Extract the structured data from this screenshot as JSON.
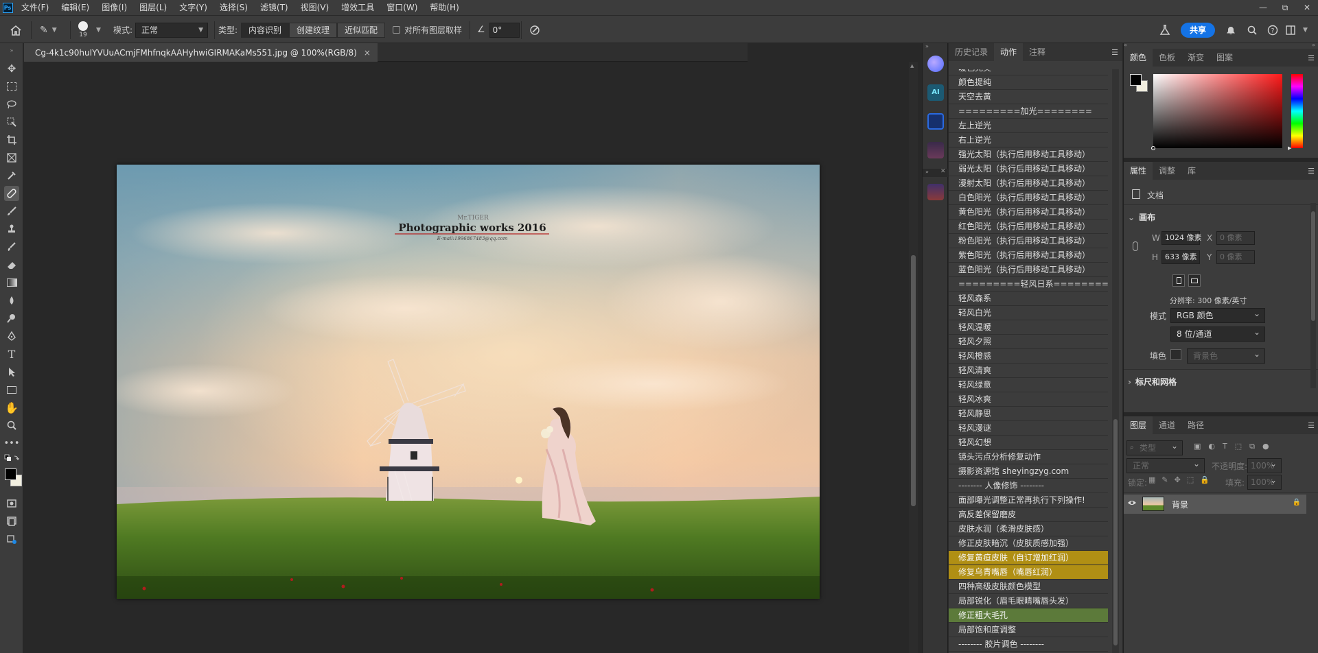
{
  "app": {
    "logo_text": "Ps"
  },
  "menubar": {
    "items": [
      "文件(F)",
      "编辑(E)",
      "图像(I)",
      "图层(L)",
      "文字(Y)",
      "选择(S)",
      "滤镜(T)",
      "视图(V)",
      "增效工具",
      "窗口(W)",
      "帮助(H)"
    ]
  },
  "window_controls": {
    "minimize": "—",
    "restore": "⧉",
    "close": "✕"
  },
  "options_bar": {
    "brush_size": "19",
    "mode_label": "模式:",
    "mode_value": "正常",
    "type_label": "类型:",
    "type_buttons": [
      "内容识别",
      "创建纹理",
      "近似匹配"
    ],
    "sample_all_label": "对所有图层取样",
    "angle_value": "0°",
    "share_label": "共享"
  },
  "document": {
    "tab_title": "Cg-4k1c90huIYVUuACmjFMhfnqkAAHyhwiGIRMAKaMs551.jpg @ 100%(RGB/8)",
    "tab_close": "×",
    "photo": {
      "watermark_small": "Mr.TIGER",
      "watermark_title": "Photographic works 2016",
      "watermark_email": "E-mail:1996867483@qq.com"
    }
  },
  "actions_panel": {
    "tabs": [
      "历史记录",
      "动作",
      "注释"
    ],
    "active_tab": "动作",
    "items": [
      {
        "label": "暖色完美",
        "style": "normal"
      },
      {
        "label": "颜色提纯",
        "style": "normal"
      },
      {
        "label": "天空去黄",
        "style": "normal"
      },
      {
        "label": "=========加光========",
        "style": "normal"
      },
      {
        "label": "左上逆光",
        "style": "normal"
      },
      {
        "label": "右上逆光",
        "style": "normal"
      },
      {
        "label": "强光太阳（执行后用移动工具移动）",
        "style": "normal"
      },
      {
        "label": "弱光太阳（执行后用移动工具移动）",
        "style": "normal"
      },
      {
        "label": "漫射太阳（执行后用移动工具移动）",
        "style": "normal"
      },
      {
        "label": "白色阳光（执行后用移动工具移动）",
        "style": "normal"
      },
      {
        "label": "黄色阳光（执行后用移动工具移动）",
        "style": "normal"
      },
      {
        "label": "红色阳光（执行后用移动工具移动）",
        "style": "normal"
      },
      {
        "label": "粉色阳光（执行后用移动工具移动）",
        "style": "normal"
      },
      {
        "label": "紫色阳光（执行后用移动工具移动）",
        "style": "normal"
      },
      {
        "label": "蓝色阳光（执行后用移动工具移动）",
        "style": "normal"
      },
      {
        "label": "=========轻风日系========",
        "style": "normal"
      },
      {
        "label": "轻风森系",
        "style": "normal"
      },
      {
        "label": "轻风白光",
        "style": "normal"
      },
      {
        "label": "轻风温暖",
        "style": "normal"
      },
      {
        "label": "轻风夕照",
        "style": "normal"
      },
      {
        "label": "轻风橙感",
        "style": "normal"
      },
      {
        "label": "轻风清爽",
        "style": "normal"
      },
      {
        "label": "轻风绿意",
        "style": "normal"
      },
      {
        "label": "轻风冰爽",
        "style": "normal"
      },
      {
        "label": "轻风静思",
        "style": "normal"
      },
      {
        "label": "轻风漫谜",
        "style": "normal"
      },
      {
        "label": "轻风幻想",
        "style": "normal"
      },
      {
        "label": "镜头污点分析修复动作",
        "style": "normal"
      },
      {
        "label": "摄影资源馆 sheyingzyg.com",
        "style": "normal"
      },
      {
        "label": "-------- 人像修饰 --------",
        "style": "normal"
      },
      {
        "label": "面部曝光调整正常再执行下列操作!",
        "style": "normal"
      },
      {
        "label": "高反差保留磨皮",
        "style": "normal"
      },
      {
        "label": "皮肤水润（柔滑皮肤感）",
        "style": "normal"
      },
      {
        "label": "修正皮肤暗沉（皮肤质感加强）",
        "style": "normal"
      },
      {
        "label": "修复黄疸皮肤（自订增加红润）",
        "style": "yellow"
      },
      {
        "label": "修复乌青嘴唇（嘴唇红润）",
        "style": "yellow"
      },
      {
        "label": "四种高级皮肤颜色模型",
        "style": "normal"
      },
      {
        "label": "局部锐化（眉毛眼睛嘴唇头发）",
        "style": "normal"
      },
      {
        "label": "修正粗大毛孔",
        "style": "green"
      },
      {
        "label": "局部饱和度调整",
        "style": "normal"
      },
      {
        "label": "-------- 胶片调色 --------",
        "style": "normal"
      }
    ]
  },
  "color_panel": {
    "tabs": [
      "颜色",
      "色板",
      "渐变",
      "图案"
    ],
    "active_tab": "颜色",
    "hue_color": "#ff1a1a"
  },
  "properties_panel": {
    "tabs": [
      "属性",
      "调整",
      "库"
    ],
    "active_tab": "属性",
    "doc_label": "文档",
    "canvas_header": "画布",
    "w_label": "W",
    "w_value": "1024 像素",
    "h_label": "H",
    "h_value": "633 像素",
    "x_label": "X",
    "x_placeholder": "0 像素",
    "y_label": "Y",
    "y_placeholder": "0 像素",
    "resolution": "分辨率: 300 像素/英寸",
    "mode_label": "模式",
    "mode_value": "RGB 颜色",
    "depth_value": "8 位/通道",
    "fill_label": "填色",
    "fill_value": "背景色",
    "rulers_header": "标尺和网格"
  },
  "layers_panel": {
    "tabs": [
      "图层",
      "通道",
      "路径"
    ],
    "active_tab": "图层",
    "search_placeholder": "类型",
    "blend_mode": "正常",
    "opacity_label": "不透明度:",
    "opacity_value": "100%",
    "lock_label": "锁定:",
    "fill_label": "填充:",
    "fill_value": "100%",
    "layers": [
      {
        "name": "背景",
        "visible": true,
        "locked": true
      }
    ]
  }
}
